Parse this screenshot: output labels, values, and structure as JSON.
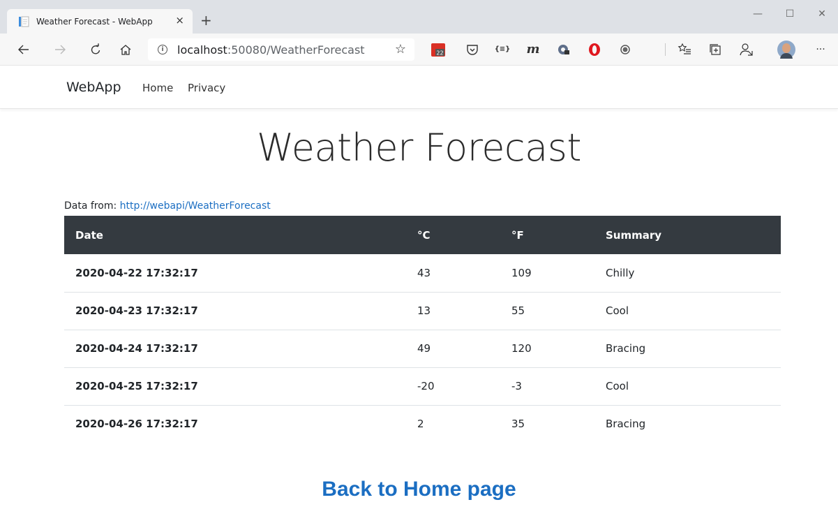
{
  "browser": {
    "tab_title": "Weather Forecast - WebApp",
    "tab_close": "×",
    "new_tab": "+",
    "minimize": "—",
    "maximize": "☐",
    "close": "✕",
    "address_host": "localhost",
    "address_rest": ":50080/WeatherForecast",
    "calendar_badge": "22",
    "reader_glyph": "{≡}",
    "m_glyph": "m",
    "more": "···"
  },
  "navbar": {
    "brand": "WebApp",
    "links": [
      "Home",
      "Privacy"
    ]
  },
  "page": {
    "title": "Weather Forecast",
    "data_from_label": "Data from:",
    "data_from_url": "http://webapi/WeatherForecast",
    "back_link": "Back to Home page"
  },
  "table": {
    "headers": [
      "Date",
      "°C",
      "°F",
      "Summary"
    ],
    "rows": [
      [
        "2020-04-22 17:32:17",
        "43",
        "109",
        "Chilly"
      ],
      [
        "2020-04-23 17:32:17",
        "13",
        "55",
        "Cool"
      ],
      [
        "2020-04-24 17:32:17",
        "49",
        "120",
        "Bracing"
      ],
      [
        "2020-04-25 17:32:17",
        "-20",
        "-3",
        "Cool"
      ],
      [
        "2020-04-26 17:32:17",
        "2",
        "35",
        "Bracing"
      ]
    ]
  },
  "colors": {
    "link": "#1b6ec2",
    "table_header_bg": "#343a40",
    "chrome_bg": "#dee1e6"
  }
}
